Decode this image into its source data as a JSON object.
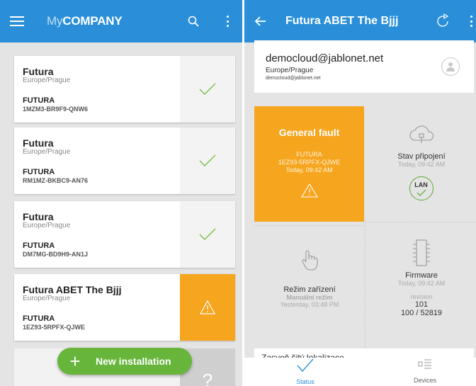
{
  "left": {
    "brand_light": "My",
    "brand_bold": "COMPANY",
    "cards": [
      {
        "name": "Futura",
        "timezone": "Europe/Prague",
        "code": "FUTURA",
        "serial": "1MZM3-BR9F9-QNW6",
        "status": "ok"
      },
      {
        "name": "Futura",
        "timezone": "Europe/Prague",
        "code": "FUTURA",
        "serial": "RM1MZ-BKBC9-AN76",
        "status": "ok"
      },
      {
        "name": "Futura",
        "timezone": "Europe/Prague",
        "code": "FUTURA",
        "serial": "DM7MG-BD9H9-AN1J",
        "status": "ok"
      },
      {
        "name": "Futura ABET The Bjjj",
        "timezone": "Europe/Prague",
        "code": "FUTURA",
        "serial": "1EZ93-5RPFX-QJWE",
        "status": "warning"
      }
    ],
    "partial_card_status": "?",
    "fab_label": "New installation"
  },
  "right": {
    "title": "Futura ABET The Bjjj",
    "account": {
      "email": "democloud@jablonet.net",
      "timezone": "Europe/Prague",
      "email_small": "democloud@jablonet.net"
    },
    "fault": {
      "title": "General fault",
      "code": "FUTURA",
      "serial": "1EZ93-5RPFX-QJWE",
      "time": "Today, 09:42 AM"
    },
    "connection": {
      "label": "Stav připojení",
      "time": "Today, 09:42 AM",
      "badge": "LAN"
    },
    "mode": {
      "label": "Režim zařízení",
      "value": "Manuální režim",
      "time": "Yesterday, 03:48 PM"
    },
    "firmware": {
      "label": "Firmware",
      "time": "Today, 09:42 AM",
      "revision_label": "revision",
      "revision": "101",
      "version": "100 / 52819"
    },
    "strip_text": "Zasvoň šitý lokalizace",
    "nav": {
      "status": "Status",
      "devices": "Devices"
    }
  },
  "colors": {
    "appbar": "#2a8fd8",
    "warning": "#f6a51f",
    "ok_check": "#76c043",
    "fab": "#68b53c"
  }
}
